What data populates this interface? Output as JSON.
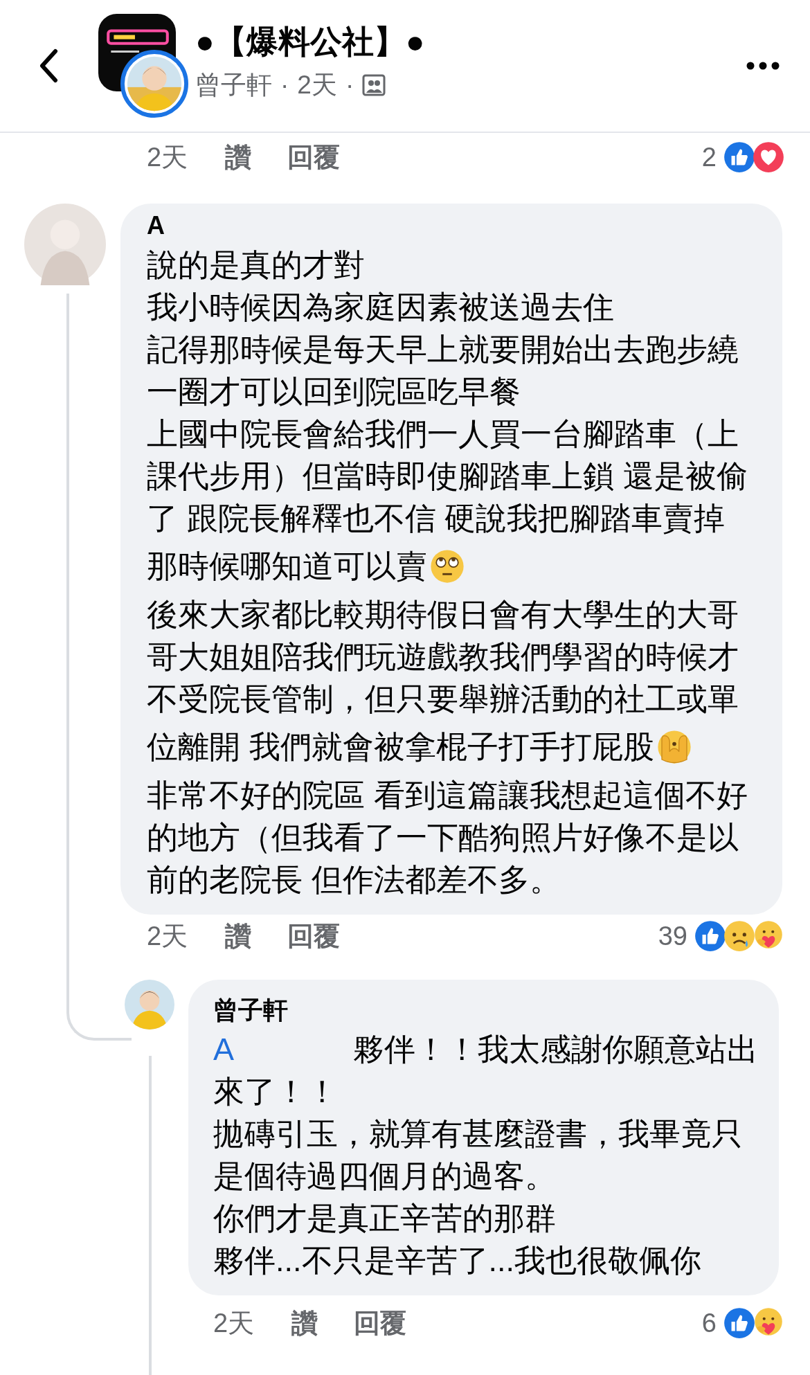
{
  "header": {
    "title": "●【爆料公社】●",
    "author": "曾子軒",
    "separator_1": "·",
    "time": "2天",
    "separator_2": "·"
  },
  "post_actions": {
    "time": "2天",
    "like": "讚",
    "reply": "回覆",
    "count": "2",
    "reactions": [
      {
        "kind": "like"
      },
      {
        "kind": "love"
      }
    ]
  },
  "comment": {
    "author": "A",
    "lines": [
      {
        "text": "說的是真的才對"
      },
      {
        "text": "我小時候因為家庭因素被送過去住"
      },
      {
        "text": "記得那時候是每天早上就要開始出去跑步繞"
      },
      {
        "text": "一圈才可以回到院區吃早餐"
      },
      {
        "text": "上國中院長會給我們一人買一台腳踏車（上"
      },
      {
        "text": "課代步用）但當時即使腳踏車上鎖 還是被偷"
      },
      {
        "text": "了 跟院長解釋也不信 硬說我把腳踏車賣掉"
      },
      {
        "text": "那時候哪知道可以賣",
        "kind": "eye_roll"
      },
      {
        "text": "後來大家都比較期待假日會有大學生的大哥"
      },
      {
        "text": "哥大姐姐陪我們玩遊戲教我們學習的時候才"
      },
      {
        "text": "不受院長管制，但只要舉辦活動的社工或單"
      },
      {
        "text": "位離開 我們就會被拿棍子打手打屁股",
        "kind": "peek"
      },
      {
        "text": "非常不好的院區 看到這篇讓我想起這個不好"
      },
      {
        "text": "的地方（但我看了一下酷狗照片好像不是以"
      },
      {
        "text": "前的老院長 但作法都差不多。"
      }
    ],
    "actions": {
      "time": "2天",
      "like": "讚",
      "reply": "回覆",
      "count": "39",
      "reactions": [
        {
          "kind": "like"
        },
        {
          "kind": "sad"
        },
        {
          "kind": "care"
        }
      ]
    }
  },
  "reply": {
    "author": "曾子軒",
    "mention": "A",
    "lines": [
      {
        "text": "夥伴！！我太感謝你願意站出"
      },
      {
        "text": "來了！！"
      },
      {
        "text": "拋磚引玉，就算有甚麼證書，我畢竟只"
      },
      {
        "text": "是個待過四個月的過客。"
      },
      {
        "text": "你們才是真正辛苦的那群"
      },
      {
        "text": "夥伴...不只是辛苦了...我也很敬佩你"
      }
    ],
    "actions": {
      "time": "2天",
      "like": "讚",
      "reply": "回覆",
      "count": "6",
      "reactions": [
        {
          "kind": "like"
        },
        {
          "kind": "care"
        }
      ]
    }
  }
}
